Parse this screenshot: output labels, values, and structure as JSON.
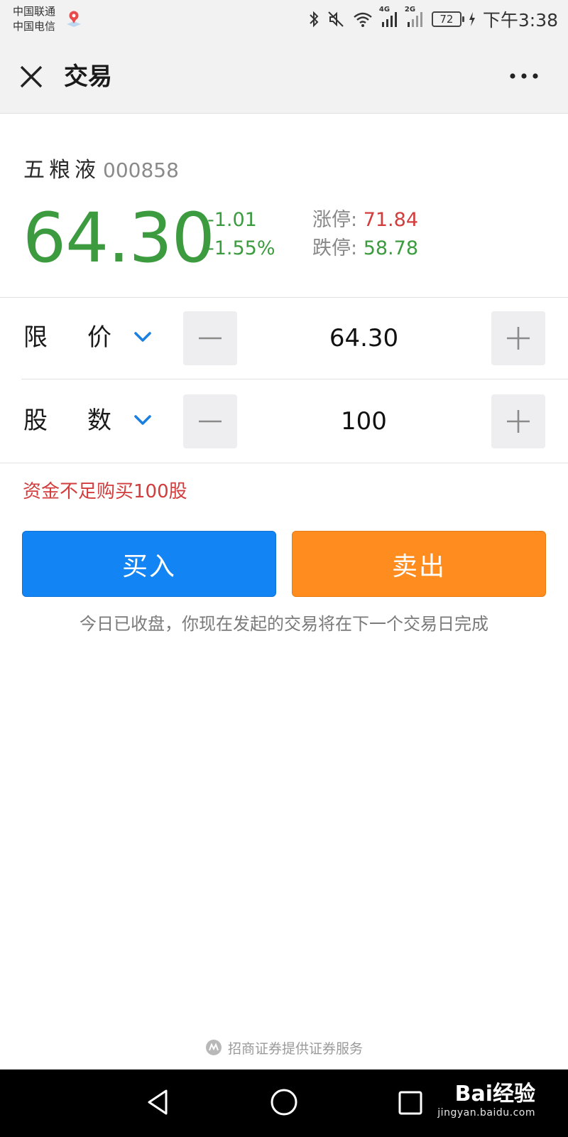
{
  "status_bar": {
    "carrier_1": "中国联通",
    "carrier_2": "中国电信",
    "network_1": "4G",
    "network_2": "2G",
    "battery": "72",
    "time": "下午3:38",
    "icons": [
      "bluetooth-icon",
      "mute-icon",
      "wifi-icon",
      "signal-icon",
      "charging-icon"
    ]
  },
  "header": {
    "title": "交易",
    "close_icon": "close-icon",
    "more_icon": "more-icon"
  },
  "stock": {
    "name": "五粮液",
    "code": "000858",
    "price": "64.30",
    "change": "-1.01",
    "change_percent": "-1.55%",
    "limit_up_label": "涨停:",
    "limit_up": "71.84",
    "limit_down_label": "跌停:",
    "limit_down": "58.78"
  },
  "order_form": {
    "price_row": {
      "label_1": "限",
      "label_2": "价",
      "value": "64.30"
    },
    "shares_row": {
      "label_1": "股",
      "label_2": "数",
      "value": "100"
    },
    "warning": "资金不足购买100股"
  },
  "actions": {
    "buy_label": "买入",
    "sell_label": "卖出"
  },
  "notice": "今日已收盘，你现在发起的交易将在下一个交易日完成",
  "footer": {
    "text": "招商证券提供证券服务"
  },
  "watermark": {
    "brand": "Bai经验",
    "url": "jingyan.baidu.com"
  },
  "colors": {
    "down_green": "#3c9b3f",
    "up_red": "#d23c3c",
    "buy_blue": "#1384f4",
    "sell_orange": "#ff8c1f",
    "chevron_blue": "#1a7fe0"
  }
}
